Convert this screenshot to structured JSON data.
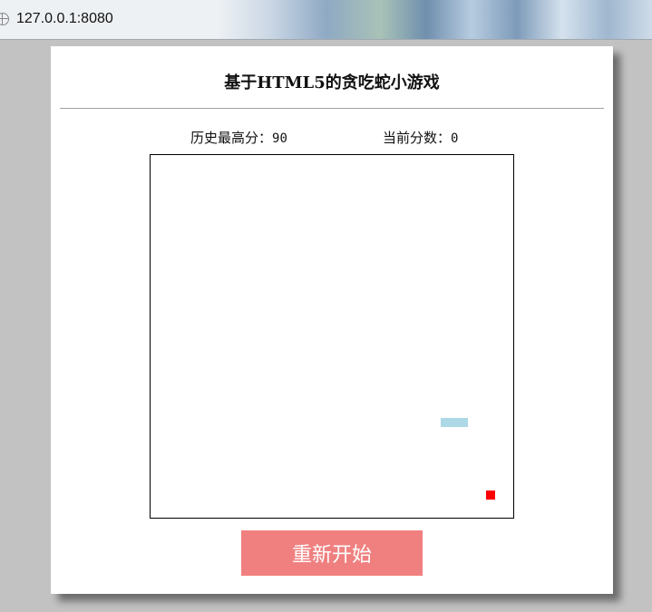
{
  "browser": {
    "url": "127.0.0.1:8080"
  },
  "game": {
    "title": "基于HTML5的贪吃蛇小游戏",
    "high_score_label": "历史最高分：",
    "high_score_value": "90",
    "current_score_label": "当前分数：",
    "current_score_value": "0",
    "restart_label": "重新开始"
  },
  "colors": {
    "snake": "#add8e6",
    "food": "#ff0000",
    "restart_button": "#f08080",
    "board_border": "#000000"
  }
}
